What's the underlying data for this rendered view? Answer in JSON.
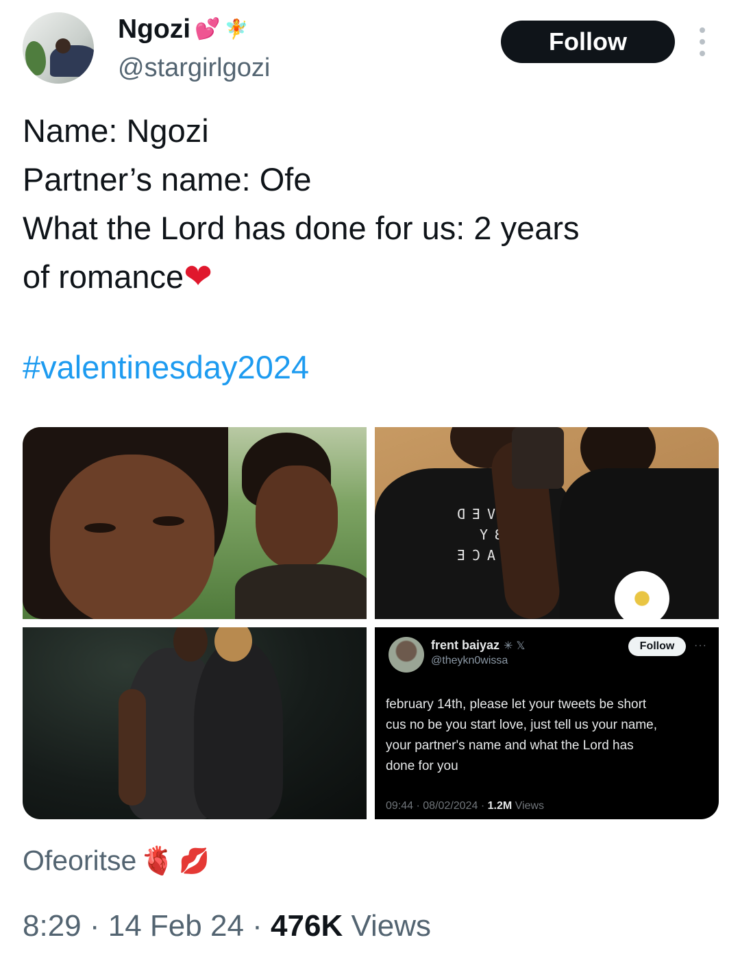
{
  "author": {
    "display_name": "Ngozi",
    "name_emojis": [
      "💕",
      "🧚"
    ],
    "handle": "@stargirlgozi"
  },
  "actions": {
    "follow_label": "Follow"
  },
  "tweet": {
    "lines": [
      "Name: Ngozi",
      "Partner’s name: Ofe",
      "What the Lord has done for us: 2 years",
      "of romance"
    ],
    "line_end_emoji": "❤",
    "hashtag": "#valentinesday2024"
  },
  "media": {
    "tile2_print": [
      "SAVED",
      "BY",
      "GRACE"
    ],
    "embedded_tweet": {
      "name": "frent baiyaz",
      "badges": "✳ 𝕏",
      "handle": "@theykn0wissa",
      "follow_label": "Follow",
      "more": "···",
      "text_lines": [
        "february 14th, please let your tweets be short",
        "cus no be you start love, just tell us your name,",
        "your partner's name and what the Lord has",
        "done for you"
      ],
      "time": "09:44",
      "date": "08/02/2024",
      "views_count": "1.2M",
      "views_label": "Views"
    }
  },
  "footer": {
    "text": "Ofeoritse",
    "emojis": [
      "🫀",
      "💋"
    ]
  },
  "meta": {
    "time": "8:29",
    "date": "14 Feb 24",
    "views_count": "476K",
    "views_label": "Views"
  },
  "colors": {
    "hashtag": "#1d9bf0",
    "follow_bg": "#0f1419",
    "secondary_text": "#536471"
  }
}
